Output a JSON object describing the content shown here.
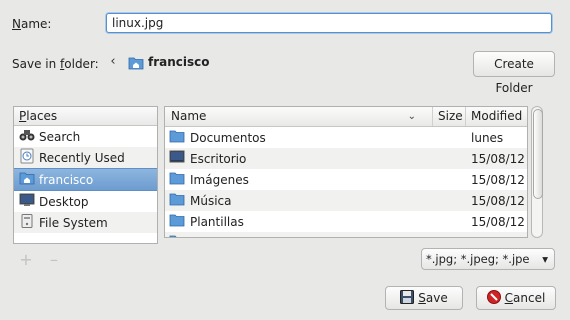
{
  "name_label": "Name:",
  "name_value": "linux.jpg",
  "folder_label": "Save in folder:",
  "current_folder": "francisco",
  "create_folder_label": "Create Folder",
  "places": {
    "header": "Places",
    "items": [
      {
        "label": "Search",
        "icon": "binoculars-icon"
      },
      {
        "label": "Recently Used",
        "icon": "clock-icon"
      },
      {
        "label": "francisco",
        "icon": "home-folder-icon",
        "selected": true
      },
      {
        "label": "Desktop",
        "icon": "desktop-icon"
      },
      {
        "label": "File System",
        "icon": "drive-icon"
      }
    ]
  },
  "files": {
    "headers": {
      "name": "Name",
      "size": "Size",
      "modified": "Modified"
    },
    "rows": [
      {
        "name": "Documentos",
        "modified": "lunes",
        "icon": "folder-icon"
      },
      {
        "name": "Escritorio",
        "modified": "15/08/12",
        "icon": "desktop-folder-icon"
      },
      {
        "name": "Imágenes",
        "modified": "15/08/12",
        "icon": "folder-icon"
      },
      {
        "name": "Música",
        "modified": "15/08/12",
        "icon": "folder-icon"
      },
      {
        "name": "Plantillas",
        "modified": "15/08/12",
        "icon": "folder-icon"
      }
    ]
  },
  "filter_value": "*.jpg; *.jpeg; *.jpe",
  "save_label": "Save",
  "cancel_label": "Cancel",
  "colors": {
    "selection": "#6d9ccf",
    "folder": "#5d9ad8"
  }
}
